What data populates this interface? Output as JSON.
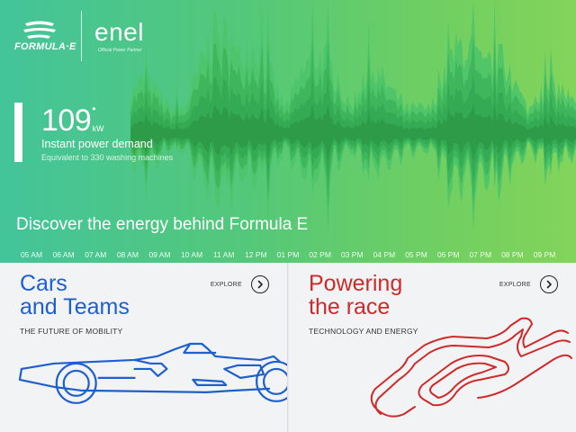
{
  "brand": {
    "formula_e": "FORMULA·E",
    "enel": "enel",
    "enel_tagline": "Official Power Partner"
  },
  "power": {
    "value": "109",
    "dot": "•",
    "unit": "kW",
    "label": "Instant power demand",
    "equivalent": "Equivalent to 330 washing machines"
  },
  "hero": {
    "headline": "Discover the energy behind Formula E"
  },
  "timeline": [
    "05 AM",
    "06 AM",
    "07 AM",
    "08 AM",
    "09 AM",
    "10 AM",
    "11 AM",
    "12 PM",
    "01 PM",
    "02 PM",
    "03 PM",
    "04 PM",
    "05 PM",
    "06 PM",
    "07 PM",
    "08 PM",
    "09 PM"
  ],
  "cards": [
    {
      "title_line1": "Cars",
      "title_line2": "and Teams",
      "subtitle": "THE FUTURE OF MOBILITY",
      "explore": "EXPLORE",
      "icon": "car-outline-icon",
      "color": "#1e5fcf"
    },
    {
      "title_line1": "Powering",
      "title_line2": "the race",
      "subtitle": "TECHNOLOGY AND ENERGY",
      "explore": "EXPLORE",
      "icon": "race-track-icon",
      "color": "#cf2a2a"
    }
  ],
  "colors": {
    "hero_start": "#43c49a",
    "hero_end": "#83d45a",
    "wave_light": "#49be5a",
    "wave_dark": "#2d9a48",
    "cars_blue": "#1e5fcf",
    "power_red": "#cf2a2a"
  }
}
